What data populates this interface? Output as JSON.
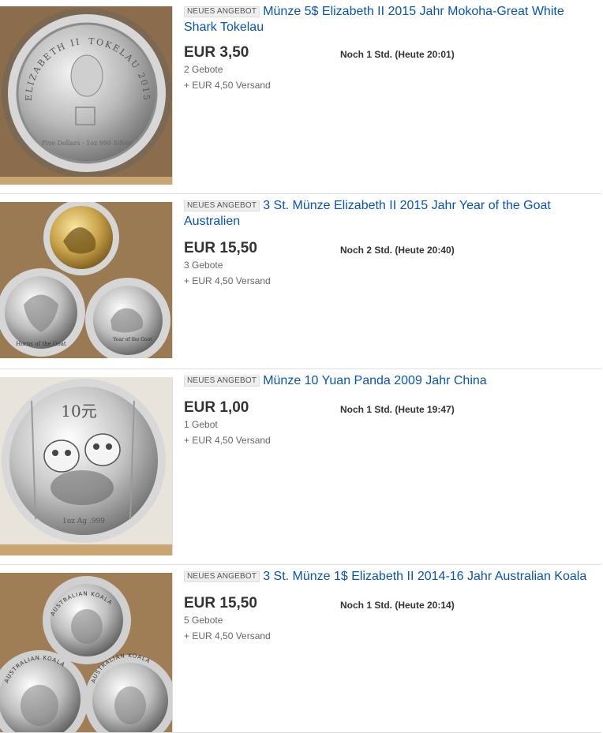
{
  "colors": {
    "link": "#0654ba",
    "price": "#333333",
    "muted": "#666666",
    "badge_bg": "#eeeeee",
    "divider": "#dddddd"
  },
  "listings": [
    {
      "badge": "NEUES ANGEBOT",
      "title": "Münze 5$ Elizabeth II 2015 Jahr Mokoha-Great White Shark Tokelau",
      "price": "EUR 3,50",
      "bids": "2 Gebote",
      "shipping": "+ EUR 4,50 Versand",
      "time_left": "Noch 1 Std. (Heute 20:01)",
      "image": {
        "coin_left_text": "ELIZABETH II",
        "coin_right_text": "TOKELAU 2015",
        "coin_bottom_text": "Five Dollars · 1oz 999 Silver"
      }
    },
    {
      "badge": "NEUES ANGEBOT",
      "title": "3 St. Münze Elizabeth II 2015 Jahr Year of the Goat Australien",
      "price": "EUR 15,50",
      "bids": "3 Gebote",
      "shipping": "+ EUR 4,50 Versand",
      "time_left": "Noch 2 Std. (Heute 20:40)",
      "image": {
        "coin_left_text": "Horns of the Goat",
        "coin_right_text": "Year of the Goat"
      }
    },
    {
      "badge": "NEUES ANGEBOT",
      "title": "Münze 10 Yuan Panda 2009 Jahr China",
      "price": "EUR 1,00",
      "bids": "1 Gebot",
      "shipping": "+ EUR 4,50 Versand",
      "time_left": "Noch 1 Std. (Heute 19:47)",
      "image": {
        "coin_value_text": "10元",
        "coin_bottom_text": "1oz Ag .999"
      }
    },
    {
      "badge": "NEUES ANGEBOT",
      "title": "3 St. Münze 1$ Elizabeth II 2014-16 Jahr Australian Koala",
      "price": "EUR 15,50",
      "bids": "5 Gebote",
      "shipping": "+ EUR 4,50 Versand",
      "time_left": "Noch 1 Std. (Heute 20:14)",
      "image": {
        "coin_top_text": "AUSTRALIAN KOALA",
        "coin_left_text": "AUSTRALIAN KOALA",
        "coin_right_text": "AUSTRALIAN KOALA"
      }
    }
  ]
}
